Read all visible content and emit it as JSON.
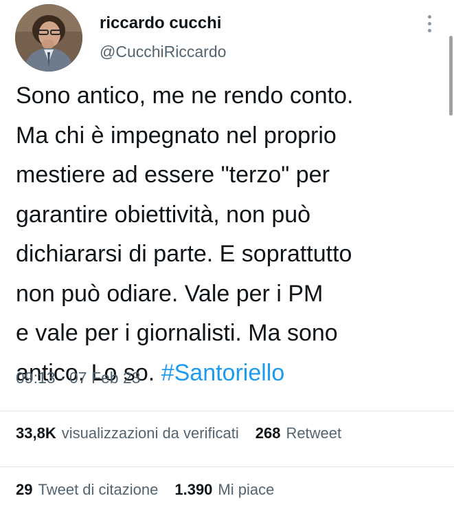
{
  "author": {
    "display_name": "riccardo cucchi",
    "handle": "@CucchiRiccardo",
    "avatar_icon": "user-avatar-photo"
  },
  "more_icon": "more-vertical-icon",
  "tweet": {
    "lines": [
      "Sono antico, me ne rendo conto.",
      "Ma chi è impegnato nel proprio",
      "mestiere ad essere \"terzo\" per",
      "garantire obiettività, non può",
      "dichiararsi di parte. E soprattutto",
      "non può odiare. Vale per i PM",
      "e vale per i giornalisti. Ma sono"
    ],
    "last_line_text": "antico. Lo so.",
    "hashtag": "#Santoriello",
    "timestamp": "09:13 · 07 Feb 23"
  },
  "stats": {
    "views": {
      "count": "33,8K",
      "label": "visualizzazioni da verificati"
    },
    "retweets": {
      "count": "268",
      "label": "Retweet"
    },
    "quotes": {
      "count": "29",
      "label": "Tweet di citazione"
    },
    "likes": {
      "count": "1.390",
      "label": "Mi piace"
    }
  },
  "colors": {
    "text_primary": "#0f1419",
    "text_secondary": "#536471",
    "link": "#1d9bf0",
    "divider": "#e1e6ea"
  }
}
